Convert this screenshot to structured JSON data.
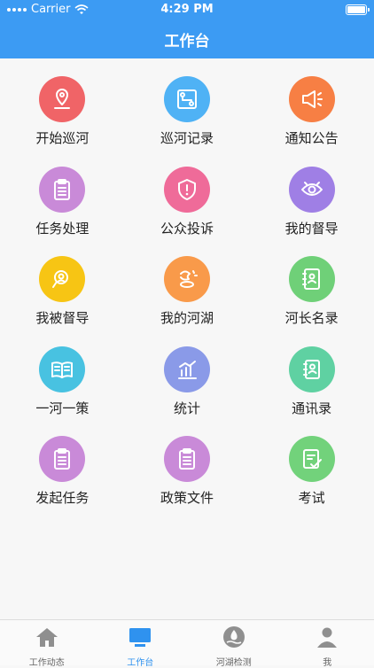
{
  "status": {
    "carrier": "Carrier",
    "time": "4:29 PM"
  },
  "header": {
    "title": "工作台"
  },
  "grid": [
    {
      "label": "开始巡河",
      "icon": "location-pin-icon",
      "color": "#f06467"
    },
    {
      "label": "巡河记录",
      "icon": "route-map-icon",
      "color": "#4fb2f5"
    },
    {
      "label": "通知公告",
      "icon": "megaphone-icon",
      "color": "#f77f44"
    },
    {
      "label": "任务处理",
      "icon": "clipboard-icon",
      "color": "#c98ad8"
    },
    {
      "label": "公众投诉",
      "icon": "shield-alert-icon",
      "color": "#ef6b99"
    },
    {
      "label": "我的督导",
      "icon": "eye-icon",
      "color": "#9f7fe5"
    },
    {
      "label": "我被督导",
      "icon": "person-search-icon",
      "color": "#f7c514"
    },
    {
      "label": "我的河湖",
      "icon": "river-lake-icon",
      "color": "#f99a4a"
    },
    {
      "label": "河长名录",
      "icon": "contact-book-icon",
      "color": "#6fd078"
    },
    {
      "label": "一河一策",
      "icon": "open-book-icon",
      "color": "#48c2e1"
    },
    {
      "label": "统计",
      "icon": "bar-chart-icon",
      "color": "#8a9ae8"
    },
    {
      "label": "通讯录",
      "icon": "contacts-icon",
      "color": "#5fd1a2"
    },
    {
      "label": "发起任务",
      "icon": "clipboard-icon",
      "color": "#c98ad8"
    },
    {
      "label": "政策文件",
      "icon": "clipboard-icon",
      "color": "#c98ad8"
    },
    {
      "label": "考试",
      "icon": "exam-check-icon",
      "color": "#72d27b"
    }
  ],
  "tabs": [
    {
      "label": "工作动态",
      "icon": "home-icon",
      "active": false
    },
    {
      "label": "工作台",
      "icon": "monitor-icon",
      "active": true
    },
    {
      "label": "河湖检测",
      "icon": "water-drop-icon",
      "active": false
    },
    {
      "label": "我",
      "icon": "user-icon",
      "active": false
    }
  ],
  "colors": {
    "header": "#3c9bf3",
    "tab_active": "#2f92ef",
    "tab_inactive": "#8f8f8f"
  }
}
